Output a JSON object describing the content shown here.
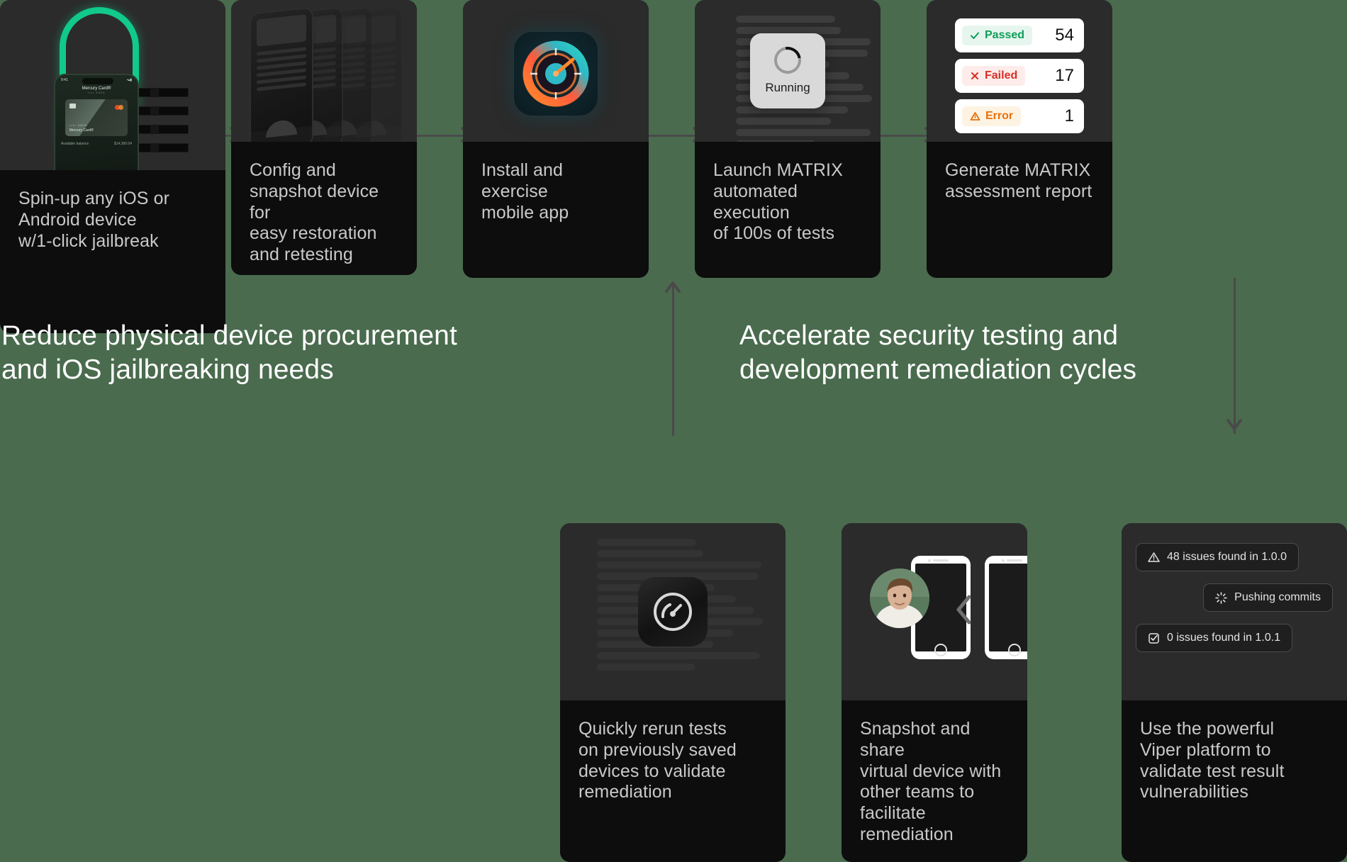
{
  "background_color": "#4a6b4e",
  "card_bg": "#2b2b2b",
  "caption_bg": "#0d0d0d",
  "caption_color": "#c9c9c9",
  "connector_color": "#4a4a4a",
  "headlines": {
    "left": "Reduce physical device procurement\nand iOS jailbreaking needs",
    "right": "Accelerate security testing and\ndevelopment remediation cycles"
  },
  "top_row": [
    {
      "id": "spin-up-device",
      "caption": "Spin-up any iOS or\nAndroid device\nw/1-click jailbreak"
    },
    {
      "id": "config-snapshot",
      "caption": "Config and\nsnapshot device for\neasy restoration\nand retesting"
    },
    {
      "id": "install-exercise-app",
      "caption": "Install and exercise\nmobile app"
    },
    {
      "id": "launch-matrix",
      "caption": "Launch MATRIX\nautomated\nexecution\nof 100s of tests"
    },
    {
      "id": "generate-report",
      "caption": "Generate MATRIX\nassessment report"
    }
  ],
  "bottom_row": [
    {
      "id": "rerun-tests",
      "caption": "Quickly rerun tests\non previously saved\ndevices to validate\nremediation"
    },
    {
      "id": "snapshot-share",
      "caption": "Snapshot and share\nvirtual device with\nother teams to\nfacilitate\nremediation"
    },
    {
      "id": "viper-platform",
      "caption": "Use the powerful\nViper platform to\nvalidate test result\nvulnerabilities"
    }
  ],
  "phone_mock": {
    "time": "9:41",
    "title": "Mercury Card®",
    "masked_number": "•••• 4329",
    "card_number": "•••• 4329",
    "card_name": "Mercury Card®",
    "balance_label": "Available balance",
    "balance_value": "$14,300.04"
  },
  "running_chip": {
    "label": "Running",
    "bg": "#d9d9d9"
  },
  "test_results": [
    {
      "status": "Passed",
      "count": "54",
      "icon": "check-icon",
      "text_color": "#0f9d58",
      "pill_bg": "#e6f6ee"
    },
    {
      "status": "Failed",
      "count": "17",
      "icon": "x-icon",
      "text_color": "#d93025",
      "pill_bg": "#fdecea"
    },
    {
      "status": "Error",
      "count": "1",
      "icon": "warning-icon",
      "text_color": "#e8710a",
      "pill_bg": "#fdf3e3"
    }
  ],
  "issue_chips": [
    {
      "icon": "warning-triangle-icon",
      "label": "48 issues found in 1.0.0"
    },
    {
      "icon": "spinner-icon",
      "label": "Pushing commits"
    },
    {
      "icon": "check-square-icon",
      "label": "0 issues found in 1.0.1"
    }
  ]
}
